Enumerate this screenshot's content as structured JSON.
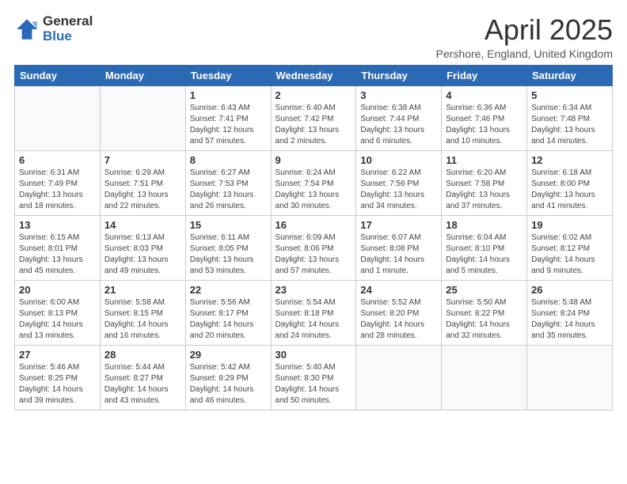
{
  "logo": {
    "general": "General",
    "blue": "Blue"
  },
  "title": "April 2025",
  "subtitle": "Pershore, England, United Kingdom",
  "days_of_week": [
    "Sunday",
    "Monday",
    "Tuesday",
    "Wednesday",
    "Thursday",
    "Friday",
    "Saturday"
  ],
  "weeks": [
    [
      {
        "day": "",
        "info": ""
      },
      {
        "day": "",
        "info": ""
      },
      {
        "day": "1",
        "info": "Sunrise: 6:43 AM\nSunset: 7:41 PM\nDaylight: 12 hours and 57 minutes."
      },
      {
        "day": "2",
        "info": "Sunrise: 6:40 AM\nSunset: 7:42 PM\nDaylight: 13 hours and 2 minutes."
      },
      {
        "day": "3",
        "info": "Sunrise: 6:38 AM\nSunset: 7:44 PM\nDaylight: 13 hours and 6 minutes."
      },
      {
        "day": "4",
        "info": "Sunrise: 6:36 AM\nSunset: 7:46 PM\nDaylight: 13 hours and 10 minutes."
      },
      {
        "day": "5",
        "info": "Sunrise: 6:34 AM\nSunset: 7:48 PM\nDaylight: 13 hours and 14 minutes."
      }
    ],
    [
      {
        "day": "6",
        "info": "Sunrise: 6:31 AM\nSunset: 7:49 PM\nDaylight: 13 hours and 18 minutes."
      },
      {
        "day": "7",
        "info": "Sunrise: 6:29 AM\nSunset: 7:51 PM\nDaylight: 13 hours and 22 minutes."
      },
      {
        "day": "8",
        "info": "Sunrise: 6:27 AM\nSunset: 7:53 PM\nDaylight: 13 hours and 26 minutes."
      },
      {
        "day": "9",
        "info": "Sunrise: 6:24 AM\nSunset: 7:54 PM\nDaylight: 13 hours and 30 minutes."
      },
      {
        "day": "10",
        "info": "Sunrise: 6:22 AM\nSunset: 7:56 PM\nDaylight: 13 hours and 34 minutes."
      },
      {
        "day": "11",
        "info": "Sunrise: 6:20 AM\nSunset: 7:58 PM\nDaylight: 13 hours and 37 minutes."
      },
      {
        "day": "12",
        "info": "Sunrise: 6:18 AM\nSunset: 8:00 PM\nDaylight: 13 hours and 41 minutes."
      }
    ],
    [
      {
        "day": "13",
        "info": "Sunrise: 6:15 AM\nSunset: 8:01 PM\nDaylight: 13 hours and 45 minutes."
      },
      {
        "day": "14",
        "info": "Sunrise: 6:13 AM\nSunset: 8:03 PM\nDaylight: 13 hours and 49 minutes."
      },
      {
        "day": "15",
        "info": "Sunrise: 6:11 AM\nSunset: 8:05 PM\nDaylight: 13 hours and 53 minutes."
      },
      {
        "day": "16",
        "info": "Sunrise: 6:09 AM\nSunset: 8:06 PM\nDaylight: 13 hours and 57 minutes."
      },
      {
        "day": "17",
        "info": "Sunrise: 6:07 AM\nSunset: 8:08 PM\nDaylight: 14 hours and 1 minute."
      },
      {
        "day": "18",
        "info": "Sunrise: 6:04 AM\nSunset: 8:10 PM\nDaylight: 14 hours and 5 minutes."
      },
      {
        "day": "19",
        "info": "Sunrise: 6:02 AM\nSunset: 8:12 PM\nDaylight: 14 hours and 9 minutes."
      }
    ],
    [
      {
        "day": "20",
        "info": "Sunrise: 6:00 AM\nSunset: 8:13 PM\nDaylight: 14 hours and 13 minutes."
      },
      {
        "day": "21",
        "info": "Sunrise: 5:58 AM\nSunset: 8:15 PM\nDaylight: 14 hours and 16 minutes."
      },
      {
        "day": "22",
        "info": "Sunrise: 5:56 AM\nSunset: 8:17 PM\nDaylight: 14 hours and 20 minutes."
      },
      {
        "day": "23",
        "info": "Sunrise: 5:54 AM\nSunset: 8:18 PM\nDaylight: 14 hours and 24 minutes."
      },
      {
        "day": "24",
        "info": "Sunrise: 5:52 AM\nSunset: 8:20 PM\nDaylight: 14 hours and 28 minutes."
      },
      {
        "day": "25",
        "info": "Sunrise: 5:50 AM\nSunset: 8:22 PM\nDaylight: 14 hours and 32 minutes."
      },
      {
        "day": "26",
        "info": "Sunrise: 5:48 AM\nSunset: 8:24 PM\nDaylight: 14 hours and 35 minutes."
      }
    ],
    [
      {
        "day": "27",
        "info": "Sunrise: 5:46 AM\nSunset: 8:25 PM\nDaylight: 14 hours and 39 minutes."
      },
      {
        "day": "28",
        "info": "Sunrise: 5:44 AM\nSunset: 8:27 PM\nDaylight: 14 hours and 43 minutes."
      },
      {
        "day": "29",
        "info": "Sunrise: 5:42 AM\nSunset: 8:29 PM\nDaylight: 14 hours and 46 minutes."
      },
      {
        "day": "30",
        "info": "Sunrise: 5:40 AM\nSunset: 8:30 PM\nDaylight: 14 hours and 50 minutes."
      },
      {
        "day": "",
        "info": ""
      },
      {
        "day": "",
        "info": ""
      },
      {
        "day": "",
        "info": ""
      }
    ]
  ]
}
